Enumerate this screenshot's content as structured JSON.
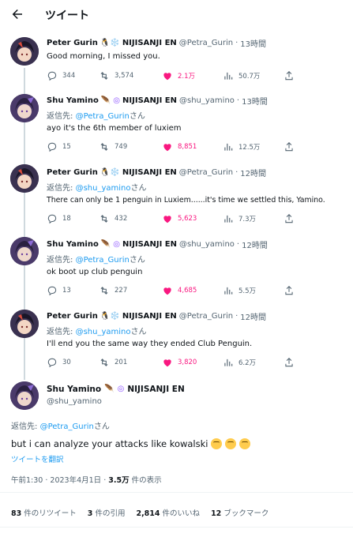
{
  "header": {
    "title": "ツイート"
  },
  "tweets": [
    {
      "name": "Peter Gurin",
      "badge": "🐧❄️",
      "handle": "@Petra_Gurin",
      "time": "13時間",
      "reply_label": "",
      "reply_to": "",
      "reply_suffix": "",
      "text": "Good morning, I missed you.",
      "replies": "344",
      "retweets": "3,574",
      "likes": "2.1万",
      "views": "50.7万"
    },
    {
      "name": "Shu Yamino",
      "badge": "🪶",
      "org": "NIJISANJI EN",
      "handle": "@shu_yamino",
      "time": "13時間",
      "reply_label": "返信先: ",
      "reply_to": "@Petra_Gurin",
      "reply_suffix": "さん",
      "text": "ayo it's the 6th member of luxiem",
      "replies": "15",
      "retweets": "749",
      "likes": "8,851",
      "views": "12.5万"
    },
    {
      "name": "Peter Gurin",
      "badge": "🐧❄️",
      "org": "NIJISANJI EN",
      "handle": "@Petra_Gurin",
      "time": "12時間",
      "reply_label": "返信先: ",
      "reply_to": "@shu_yamino",
      "reply_suffix": "さん",
      "text": "There can only be 1 penguin in Luxiem......it's time we settled this, Yamino.",
      "replies": "18",
      "retweets": "432",
      "likes": "5,623",
      "views": "7.3万"
    },
    {
      "name": "Shu Yamino",
      "badge": "🪶",
      "org": "NIJISANJI EN",
      "handle": "@shu_yamino",
      "time": "12時間",
      "reply_label": "返信先: ",
      "reply_to": "@Petra_Gurin",
      "reply_suffix": "さん",
      "text": "ok boot up club penguin",
      "replies": "13",
      "retweets": "227",
      "likes": "4,685",
      "views": "5.5万"
    },
    {
      "name": "Peter Gurin",
      "badge": "🐧❄️",
      "org": "NIJISANJI EN",
      "handle": "@Petra_Gurin",
      "time": "12時間",
      "reply_label": "返信先: ",
      "reply_to": "@shu_yamino",
      "reply_suffix": "さん",
      "text": "I'll end you the same way they ended Club Penguin.",
      "replies": "30",
      "retweets": "201",
      "likes": "3,820",
      "views": "6.2万"
    }
  ],
  "first_org": "NIJISANJI EN",
  "main": {
    "name": "Shu Yamino",
    "org": "NIJISANJI EN",
    "handle": "@shu_yamino",
    "reply_label": "返信先: ",
    "reply_to": "@Petra_Gurin",
    "reply_suffix": "さん",
    "text": "but i can analyze your attacks like kowalski",
    "translate": "ツイートを翻訳",
    "time": "午前1:30",
    "date": "2023年4月1日",
    "views_count": "3.5万",
    "views_label": "件の表示"
  },
  "stats": {
    "retweets_count": "83",
    "retweets_label": "件のリツイート",
    "quotes_count": "3",
    "quotes_label": "件の引用",
    "likes_count": "2,814",
    "likes_label": "件のいいね",
    "bookmarks_count": "12",
    "bookmarks_label": "ブックマーク"
  },
  "colors": {
    "accent": "#1d9bf0",
    "like": "#f91880",
    "muted": "#536471"
  }
}
